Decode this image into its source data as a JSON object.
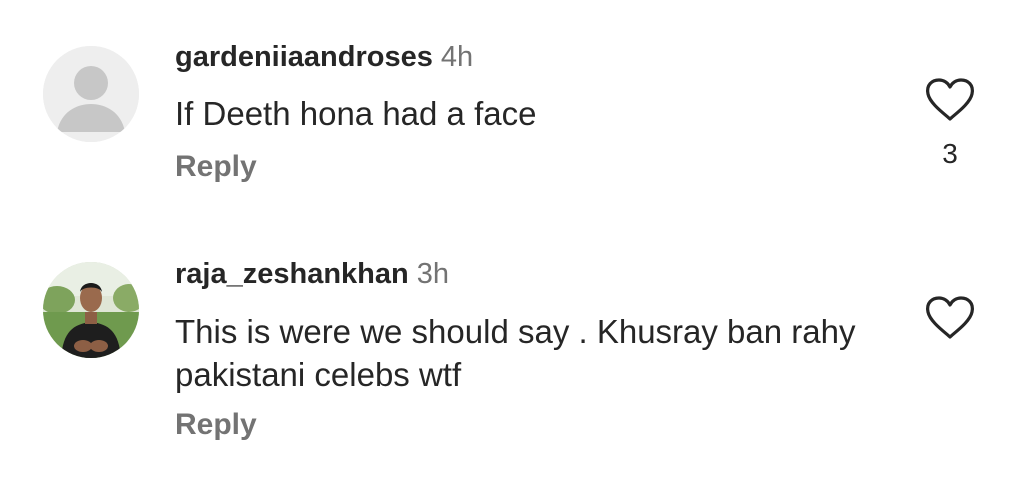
{
  "comments": [
    {
      "username": "gardeniiaandroses",
      "time": "4h",
      "text": "If Deeth hona had a face",
      "reply_label": "Reply",
      "like_count": "3",
      "avatar_icon": "default-avatar-icon"
    },
    {
      "username": "raja_zeshankhan",
      "time": "3h",
      "text": "This is were we should say . Khusray ban rahy pakistani celebs wtf",
      "reply_label": "Reply",
      "avatar_icon": "profile-photo"
    }
  ],
  "colors": {
    "primary_text": "#262626",
    "secondary_text": "#737373",
    "background": "#ffffff",
    "avatar_placeholder": "#c7c7c7"
  }
}
